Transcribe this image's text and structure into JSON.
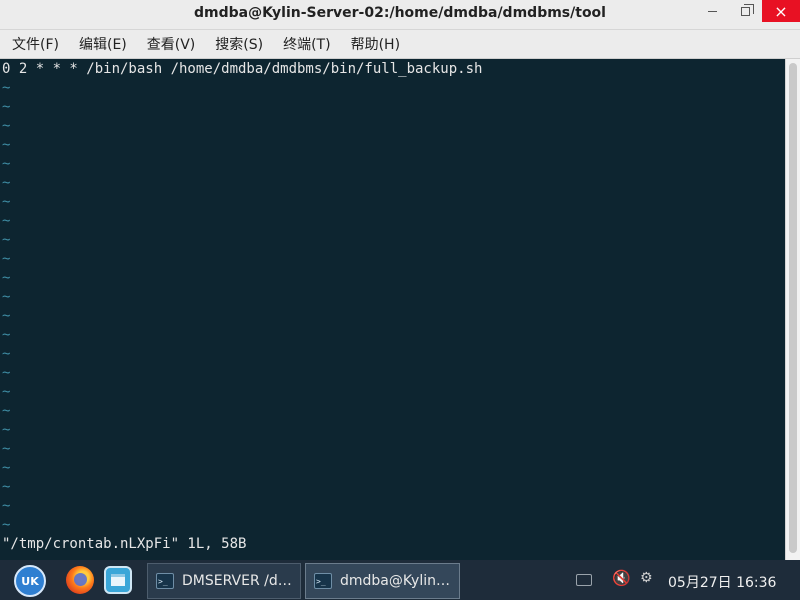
{
  "window": {
    "title": "dmdba@Kylin-Server-02:/home/dmdba/dmdbms/tool",
    "close_glyph": "×"
  },
  "menu": [
    {
      "label": "文件(F)"
    },
    {
      "label": "编辑(E)"
    },
    {
      "label": "查看(V)"
    },
    {
      "label": "搜索(S)"
    },
    {
      "label": "终端(T)"
    },
    {
      "label": "帮助(H)"
    }
  ],
  "terminal": {
    "first_line": "0 2 * * * /bin/bash /home/dmdba/dmdbms/bin/full_backup.sh",
    "tilde_char": "~",
    "tilde_count": 24,
    "status_line": "\"/tmp/crontab.nLXpFi\" 1L, 58B"
  },
  "taskbar": {
    "start_label": "UK",
    "tasks": [
      {
        "label": "DMSERVER /d…"
      },
      {
        "label": "dmdba@Kylin…"
      }
    ],
    "volume_icon": "🔇",
    "network_icon": "⚙",
    "clock": "05月27日 16:36"
  },
  "colors": {
    "terminal_bg": "#0d2530",
    "tilde": "#3f8ea5",
    "close_button": "#e81123",
    "taskbar_bg": "#1e2c3a"
  }
}
